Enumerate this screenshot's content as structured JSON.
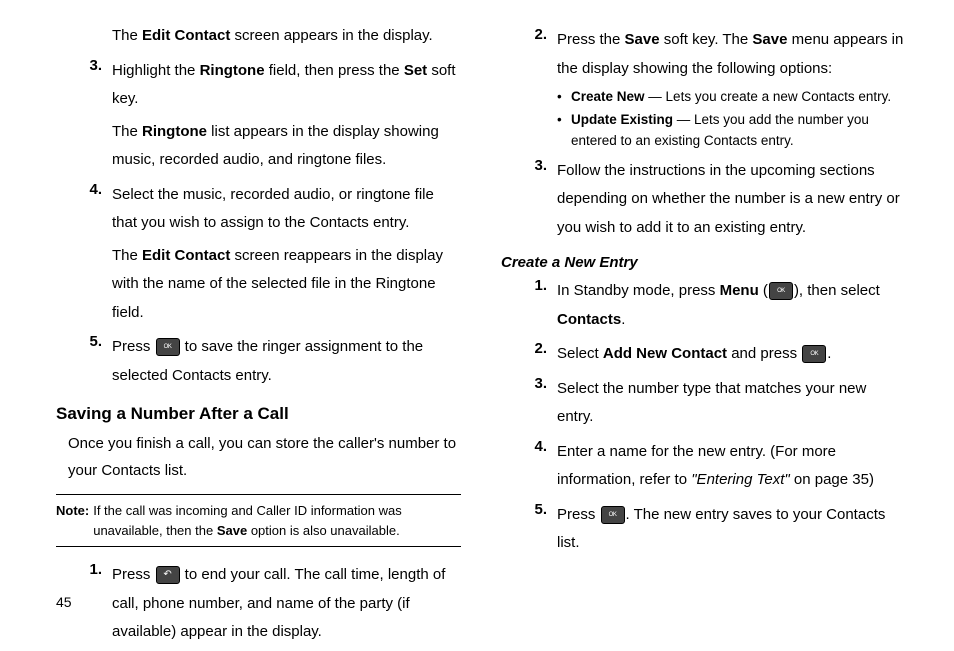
{
  "page_number": "45",
  "left": {
    "p1_a": "The ",
    "p1_b": "Edit Contact",
    "p1_c": " screen appears in the display.",
    "s3_num": "3.",
    "s3_a": "Highlight the ",
    "s3_b": "Ringtone",
    "s3_c": " field, then press the ",
    "s3_d": "Set",
    "s3_e": " soft key.",
    "s3_f_a": "The ",
    "s3_f_b": "Ringtone",
    "s3_f_c": " list appears in the display showing music, recorded audio, and ringtone files.",
    "s4_num": "4.",
    "s4_a": "Select the music, recorded audio, or ringtone file that you wish to assign to the Contacts entry.",
    "s4_b_a": "The ",
    "s4_b_b": "Edit Contact",
    "s4_b_c": " screen reappears in the display with the name of the selected file in the Ringtone field.",
    "s5_num": "5.",
    "s5_a": "Press ",
    "s5_b": " to save the ringer assignment to the selected Contacts entry.",
    "h2": "Saving a Number After a Call",
    "intro": "Once you finish a call, you can store the caller's number to your Contacts list.",
    "note_label": "Note:",
    "note_a": " If the call was incoming and Caller ID information was unavailable, then the ",
    "note_b": "Save",
    "note_c": " option is also unavailable.",
    "b1_num": "1.",
    "b1_a": "Press ",
    "b1_b": " to end your call. The call time, length of call, phone number, and name of the party (if available) appear in the display."
  },
  "right": {
    "s2_num": "2.",
    "s2_a": "Press the ",
    "s2_b": "Save",
    "s2_c": " soft key. The ",
    "s2_d": "Save",
    "s2_e": " menu appears in the display showing the following options:",
    "bul1_a": "Create New",
    "bul1_b": " — Lets you create a new Contacts entry.",
    "bul2_a": "Update Existing",
    "bul2_b": " — Lets you add the number you entered to an existing Contacts entry.",
    "s3_num": "3.",
    "s3_a": "Follow the instructions in the upcoming sections depending on whether the number is a new entry or you wish to add it to an existing entry.",
    "h3": "Create a New Entry",
    "c1_num": "1.",
    "c1_a": "In Standby mode, press ",
    "c1_b": "Menu",
    "c1_c": " (",
    "c1_d": "), then select ",
    "c1_e": "Contacts",
    "c1_f": ".",
    "c2_num": "2.",
    "c2_a": "Select ",
    "c2_b": "Add New Contact",
    "c2_c": " and press ",
    "c2_d": ".",
    "c3_num": "3.",
    "c3_a": "Select the number type that matches your new entry.",
    "c4_num": "4.",
    "c4_a": "Enter a name for the new entry. (For more information, refer to ",
    "c4_b": "\"Entering Text\"",
    "c4_c": "  on page 35)",
    "c5_num": "5.",
    "c5_a": "Press ",
    "c5_b": ". The new entry saves to your Contacts list."
  }
}
